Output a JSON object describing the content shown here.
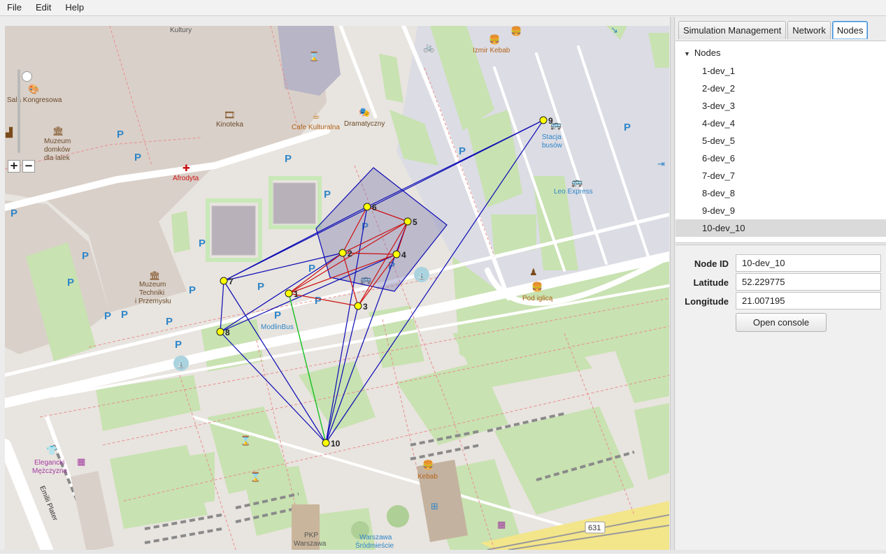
{
  "menu": {
    "items": [
      "File",
      "Edit",
      "Help"
    ]
  },
  "tabs": [
    {
      "label": "Simulation Management",
      "active": false
    },
    {
      "label": "Network",
      "active": false
    },
    {
      "label": "Nodes",
      "active": true
    }
  ],
  "tree": {
    "root_label": "Nodes",
    "items": [
      "1-dev_1",
      "2-dev_2",
      "3-dev_3",
      "4-dev_4",
      "5-dev_5",
      "6-dev_6",
      "7-dev_7",
      "8-dev_8",
      "9-dev_9",
      "10-dev_10"
    ],
    "selected": "10-dev_10"
  },
  "properties": {
    "node_id_label": "Node ID",
    "node_id_value": "10-dev_10",
    "latitude_label": "Latitude",
    "latitude_value": "52.229775",
    "longitude_label": "Longitude",
    "longitude_value": "21.007195",
    "open_console_label": "Open console"
  },
  "map": {
    "place_labels": {
      "kultury": "Kultury",
      "sala": "Sala Kongresowa",
      "muzeum_domkow_1": "Muzeum",
      "muzeum_domkow_2": "domków",
      "muzeum_domkow_3": "dla lalek",
      "kinoteka": "Kinoteka",
      "cafe": "Cafe Kulturalna",
      "dramatyczny": "Dramatyczny",
      "izmir": "Izmir Kebab",
      "afrodyta": "Afrodyta",
      "stacja_1": "Stacja",
      "stacja_2": "busów",
      "leo": "Leo Express",
      "muzeum_tech_1": "Muzeum",
      "muzeum_tech_2": "Techniki",
      "muzeum_tech_3": "i Przemysłu",
      "modlinbus": "ModlinBus",
      "podiglica": "Pod iglicą",
      "elegancki_1": "Elegancki",
      "elegancki_2": "Mężczyzna",
      "emilii": "Emilii Plater",
      "kebab": "Kebab",
      "pkp_1": "PKP",
      "pkp_2": "Warszawa",
      "warszawa_1": "Warszawa",
      "warszawa_2": "Śródmieście",
      "road_631": "631"
    },
    "parking_label": "P",
    "zoom_in_label": "+",
    "zoom_out_label": "−",
    "zoom_level": 0.95,
    "node_labels": [
      "1",
      "2",
      "3",
      "4",
      "5",
      "6",
      "7",
      "8",
      "9",
      "10"
    ],
    "colors": {
      "node_fill": "#ffff00",
      "red_link": "#cc1111",
      "blue_link": "#0a0ab4",
      "green_link": "#22cc22"
    }
  }
}
